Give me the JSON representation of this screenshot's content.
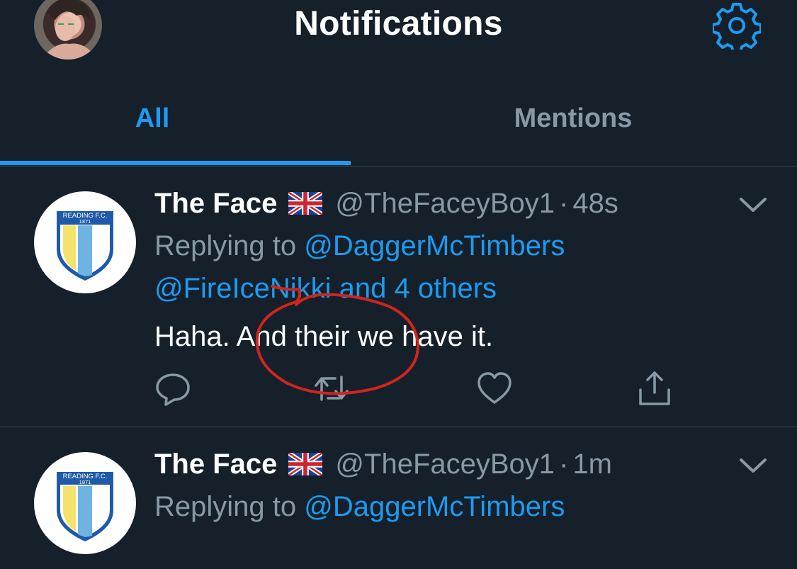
{
  "header": {
    "title": "Notifications",
    "avatar_icon": "profile-avatar",
    "settings_icon": "gear-icon"
  },
  "tabs": [
    {
      "label": "All",
      "active": true
    },
    {
      "label": "Mentions",
      "active": false
    }
  ],
  "tweets": [
    {
      "display_name": "The Face",
      "flag_icon": "uk-flag-icon",
      "handle": "@TheFaceyBoy1",
      "separator": "·",
      "time": "48s",
      "replying_prefix": "Replying to ",
      "replying_user": "@DaggerMcTimbers",
      "replying_more": "@FireIceNikki and 4 others",
      "text": "Haha. And their we have it.",
      "avatar": {
        "club_text": "READING F.C.",
        "year": "1871"
      }
    },
    {
      "display_name": "The Face",
      "flag_icon": "uk-flag-icon",
      "handle": "@TheFaceyBoy1",
      "separator": "·",
      "time": "1m",
      "replying_prefix": "Replying to ",
      "replying_user": "@DaggerMcTimbers",
      "avatar": {
        "club_text": "READING F.C.",
        "year": "1871"
      }
    }
  ],
  "colors": {
    "background": "#15202b",
    "accent": "#1d9bf0",
    "muted": "#8899a6",
    "annotation": "#d0251c"
  }
}
